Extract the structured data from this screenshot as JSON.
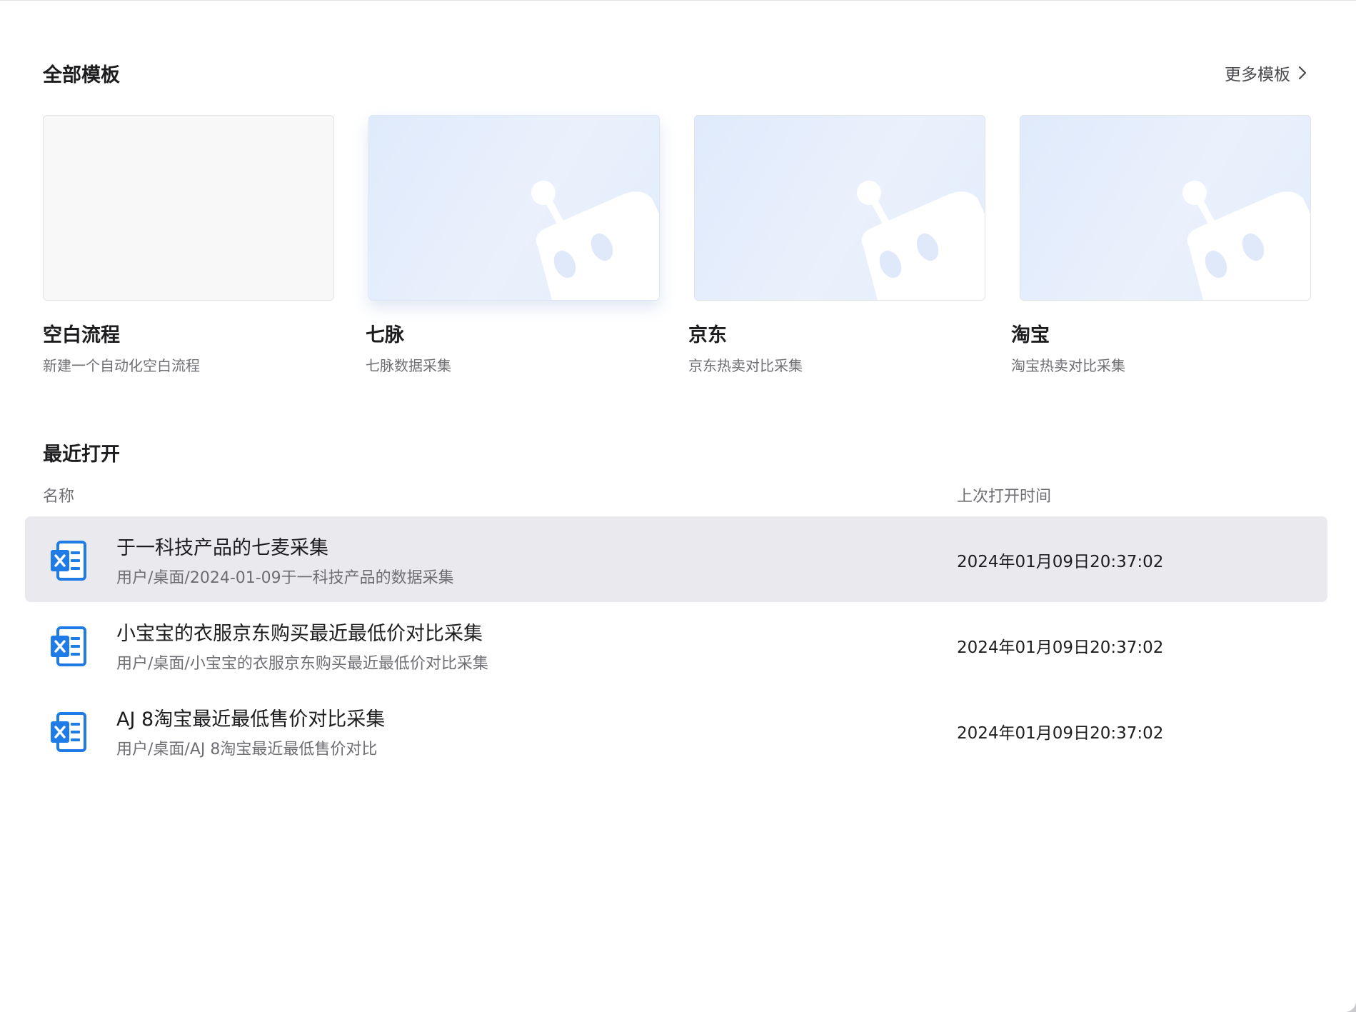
{
  "templates": {
    "title": "全部模板",
    "more_label": "更多模板",
    "cards": [
      {
        "name": "空白流程",
        "desc": "新建一个自动化空白流程"
      },
      {
        "name": "七脉",
        "desc": "七脉数据采集"
      },
      {
        "name": "京东",
        "desc": "京东热卖对比采集"
      },
      {
        "name": "淘宝",
        "desc": "淘宝热卖对比采集"
      }
    ]
  },
  "recent": {
    "title": "最近打开",
    "col_name": "名称",
    "col_time": "上次打开时间",
    "rows": [
      {
        "name": "于一科技产品的七麦采集",
        "path": "用户/桌面/2024-01-09于一科技产品的数据采集",
        "time": "2024年01月09日20:37:02",
        "selected": true
      },
      {
        "name": "小宝宝的衣服京东购买最近最低价对比采集",
        "path": "用户/桌面/小宝宝的衣服京东购买最近最低价对比采集",
        "time": "2024年01月09日20:37:02",
        "selected": false
      },
      {
        "name": "AJ 8淘宝最近最低售价对比采集",
        "path": "用户/桌面/AJ 8淘宝最近最低售价对比",
        "time": "2024年01月09日20:37:02",
        "selected": false
      }
    ]
  },
  "icons": {
    "more": "chevron-right-icon",
    "robot": "robot-icon",
    "file": "excel-file-icon"
  },
  "colors": {
    "accent": "#1f7ce6",
    "selected_row": "#e9e9ee",
    "card_gradient_start": "#dfeafb"
  }
}
